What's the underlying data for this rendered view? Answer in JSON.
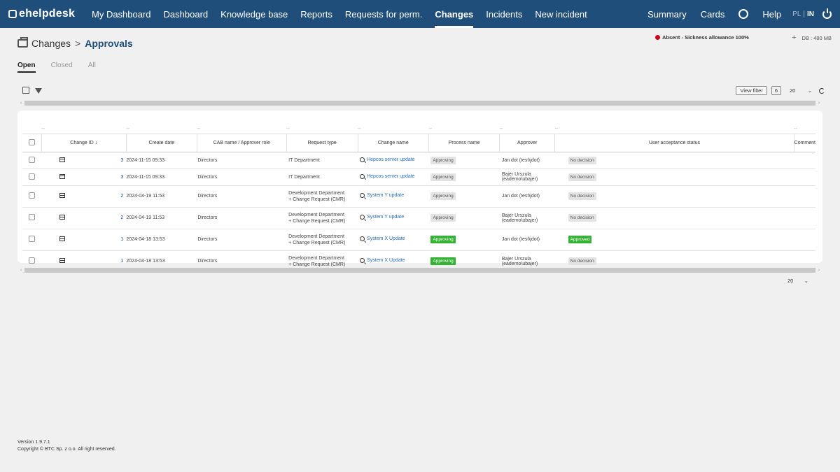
{
  "nav": {
    "logo": "ehelpdesk",
    "items": [
      {
        "label": "My Dashboard",
        "name": "nav-my-dashboard"
      },
      {
        "label": "Dashboard",
        "name": "nav-dashboard"
      },
      {
        "label": "Knowledge base",
        "name": "nav-knowledge-base"
      },
      {
        "label": "Reports",
        "name": "nav-reports"
      },
      {
        "label": "Requests for perm.",
        "name": "nav-requests-for-perm"
      },
      {
        "label": "Changes",
        "name": "nav-changes",
        "active": true
      },
      {
        "label": "Incidents",
        "name": "nav-incidents"
      },
      {
        "label": "New incident",
        "name": "nav-new-incident"
      }
    ],
    "right": {
      "summary": "Summary",
      "cards": "Cards",
      "help": "Help",
      "lang_pl": "PL",
      "lang_sep": "|",
      "lang_in": "IN"
    }
  },
  "header": {
    "breadcrumb_root": "Changes",
    "breadcrumb_sep": ">",
    "breadcrumb_current": "Approvals",
    "status_text": "Absent - Sickness allowance 100%",
    "status_color": "#d0001a",
    "db_plus": "+",
    "db_label": "DB : 480 MB"
  },
  "tabs": [
    {
      "label": "Open",
      "active": true
    },
    {
      "label": "Closed"
    },
    {
      "label": "All"
    }
  ],
  "toolbar": {
    "view_filter": "View filter",
    "count": "6",
    "page_size": "20",
    "page_size_arrow": "⌄"
  },
  "table": {
    "filter_placeholder": "--",
    "sort_marker": "↓",
    "columns": [
      "Change ID",
      "Create date",
      "CAB name / Approver role",
      "Request type",
      "Change name",
      "Process name",
      "Approver",
      "User acceptance status",
      "Comment"
    ],
    "rows": [
      {
        "id": "3",
        "date": "2024-11-15 09:33",
        "cab": "Directors",
        "req": "IT Department",
        "name": "Hepcos server update",
        "process": "Approving",
        "process_green": false,
        "approver": "Jan dot (test\\jdot)",
        "status": "No decision",
        "status_green": false,
        "comment": ""
      },
      {
        "id": "3",
        "date": "2024-11-15 09:33",
        "cab": "Directors",
        "req": "IT Department",
        "name": "Hepcos server update",
        "process": "Approving",
        "process_green": false,
        "approver": "Bajer Urszula (eademo\\ubajer)",
        "status": "No decision",
        "status_green": false,
        "comment": ""
      },
      {
        "id": "2",
        "date": "2024-04-19 11:53",
        "cab": "Directors",
        "req": "Development Department + Change Request (CMR)",
        "name": "System Y update",
        "process": "Approving",
        "process_green": false,
        "approver": "Jan dot (test\\jdot)",
        "status": "No decision",
        "status_green": false,
        "comment": ""
      },
      {
        "id": "2",
        "date": "2024-04-19 11:53",
        "cab": "Directors",
        "req": "Development Department + Change Request (CMR)",
        "name": "System Y update",
        "process": "Approving",
        "process_green": false,
        "approver": "Bajer Urszula (eademo\\ubajer)",
        "status": "No decision",
        "status_green": false,
        "comment": ""
      },
      {
        "id": "1",
        "date": "2024-04-18 13:53",
        "cab": "Directors",
        "req": "Development Department + Change Request (CMR)",
        "name": "System X Update",
        "process": "Approving",
        "process_green": true,
        "approver": "Jan dot (test\\jdot)",
        "status": "Approved",
        "status_green": true,
        "comment": ""
      },
      {
        "id": "1",
        "date": "2024-04-18 13:53",
        "cab": "Directors",
        "req": "Development Department + Change Request (CMR)",
        "name": "System X Update",
        "process": "Approving",
        "process_green": true,
        "approver": "Bajer Urszula (eademo\\ubajer)",
        "status": "No decision",
        "status_green": false,
        "comment": ""
      }
    ]
  },
  "pagination": {
    "page_size": "20",
    "arrow": "⌄"
  },
  "scroll": {
    "left_arrow": "‹",
    "right_arrow": "›"
  },
  "footer": {
    "version": "Version 1.9.7.1",
    "copyright": "Copyright © BTC Sp. z o.o. All right reserved."
  },
  "colors": {
    "nav_bg": "#1f4e7a",
    "link": "#2a6ebb",
    "green_badge": "#34b233"
  }
}
